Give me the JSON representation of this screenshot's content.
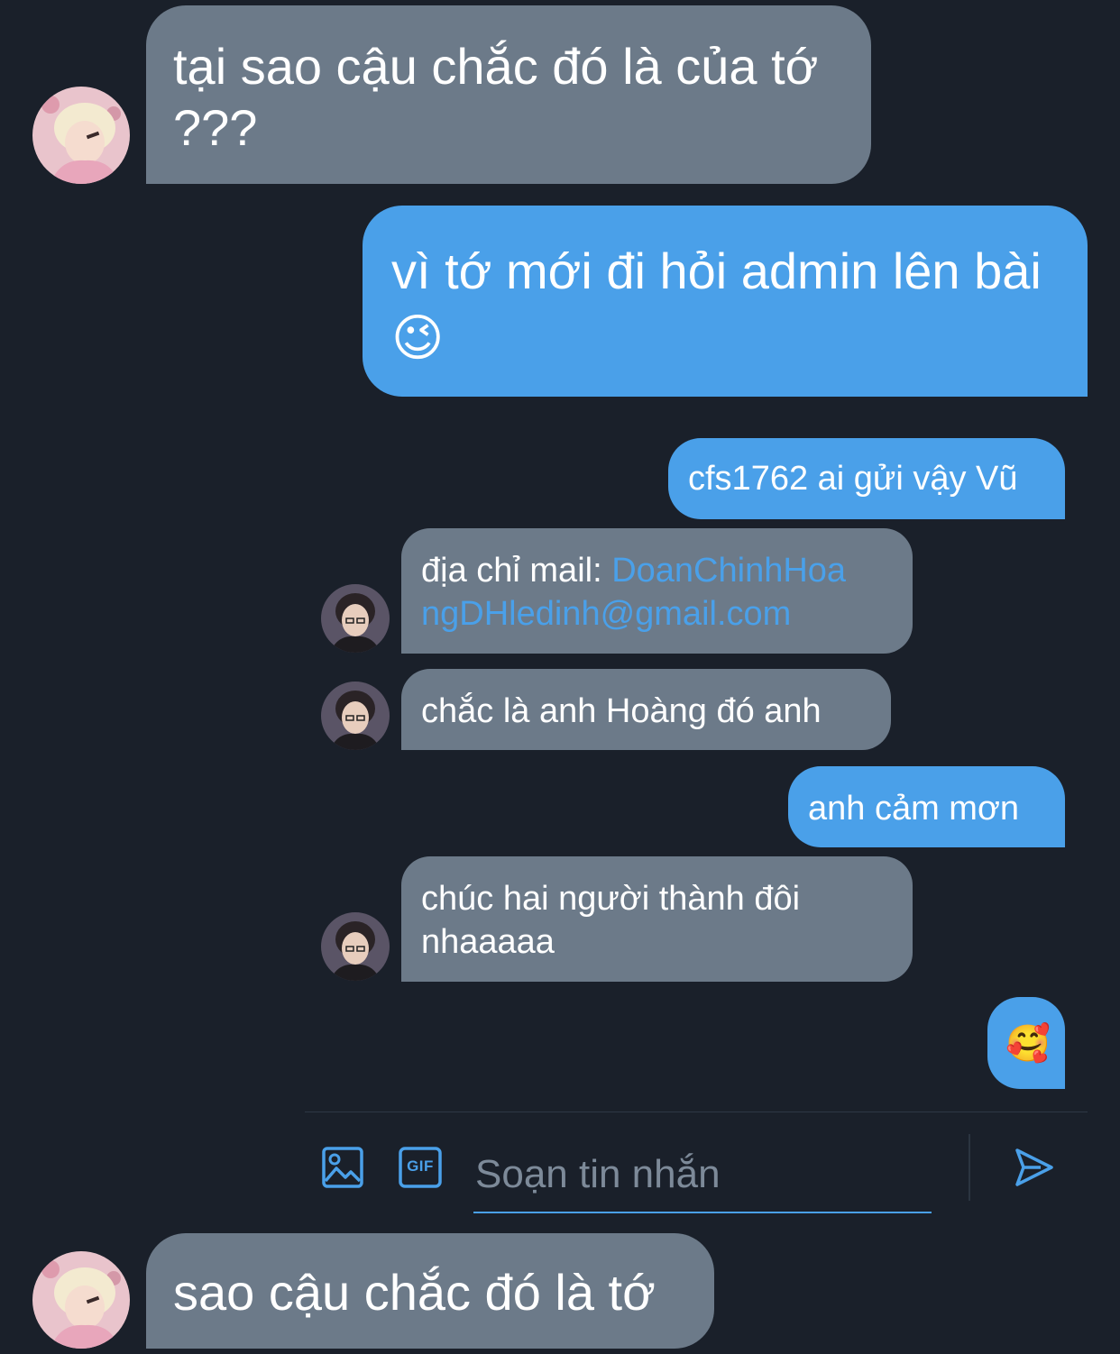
{
  "messages": [
    {
      "side": "received",
      "text": "tại sao cậu chắc đó là của tớ ???"
    },
    {
      "side": "sent",
      "text": "vì tớ mới đi hỏi admin lên bài",
      "emoji": "😉"
    },
    {
      "side": "sent",
      "text": "cfs1762 ai gửi vậy Vũ"
    },
    {
      "side": "received",
      "prefix": "địa chỉ mail: ",
      "link": "DoanChinhHoangDHledinh@gmail.com",
      "link_line1": "DoanChinhHoa",
      "link_line2": "ngDHledinh@gmail.com"
    },
    {
      "side": "received",
      "text": "chắc là anh Hoàng đó anh"
    },
    {
      "side": "sent",
      "text": "anh cảm mơn"
    },
    {
      "side": "received",
      "text": "chúc hai người thành đôi nhaaaaa"
    },
    {
      "side": "sent",
      "emoji": "🥰"
    },
    {
      "side": "received",
      "text": "sao cậu chắc đó là tớ"
    }
  ],
  "composer": {
    "placeholder": "Soạn tin nhắn",
    "image_icon": "image-icon",
    "gif_icon": "gif-icon",
    "gif_label": "GIF",
    "send_icon": "send-icon"
  },
  "colors": {
    "background": "#1a202a",
    "received_bubble": "#6c7a89",
    "sent_bubble": "#4aa0e9",
    "accent": "#4aa0e9"
  }
}
